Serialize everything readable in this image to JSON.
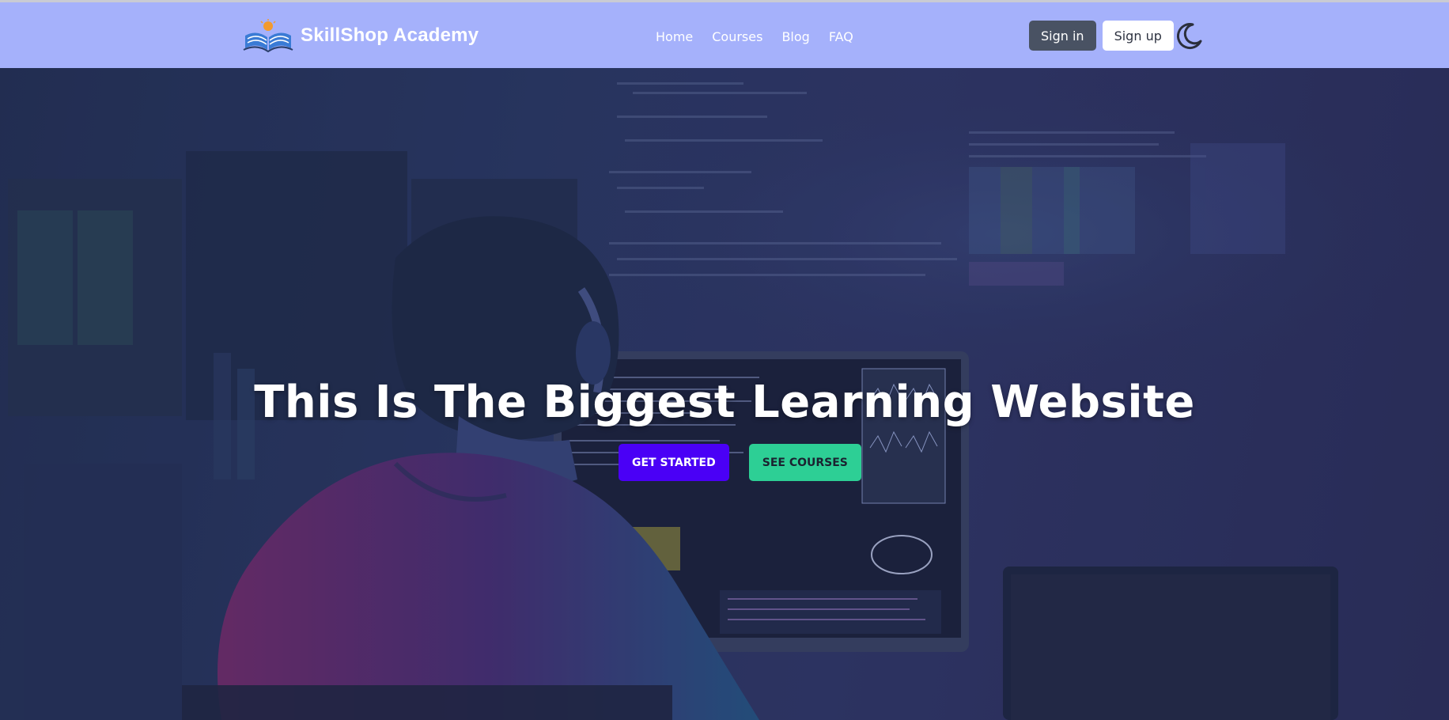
{
  "brand": {
    "name": "SkillShop Academy",
    "logo_icon": "open-book-logo"
  },
  "nav": {
    "links": [
      "Home",
      "Courses",
      "Blog",
      "FAQ"
    ]
  },
  "auth": {
    "signin_label": "Sign in",
    "signup_label": "Sign up",
    "theme_toggle_icon": "moon-icon"
  },
  "hero": {
    "title": "This Is The Biggest Learning Website",
    "primary_cta": "GET STARTED",
    "secondary_cta": "SEE COURSES",
    "background_image": "person-with-headphones-coding-at-monitor"
  },
  "colors": {
    "navbar_bg": "#a5b1fb",
    "signin_bg": "#495263",
    "primary_cta_bg": "#4a00f6",
    "secondary_cta_bg": "#2dcf95"
  }
}
